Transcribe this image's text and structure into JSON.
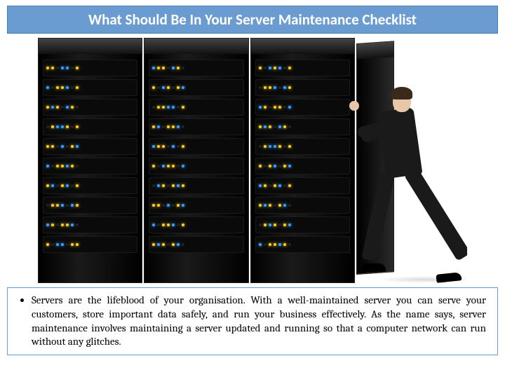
{
  "title": "What Should Be In Your Server Maintenance Checklist",
  "body": {
    "bullet1": "Servers are the lifeblood of your organisation. With a well-maintained server you can serve your customers, store important data safely, and run your business effectively. As the name says, server maintenance involves maintaining a server updated and running so that a computer network can run without any glitches."
  },
  "image": {
    "description": "Photograph of black server racks with yellow and blue indicator lights; a man in a dark suit pushes a rack door closed on the right side."
  }
}
